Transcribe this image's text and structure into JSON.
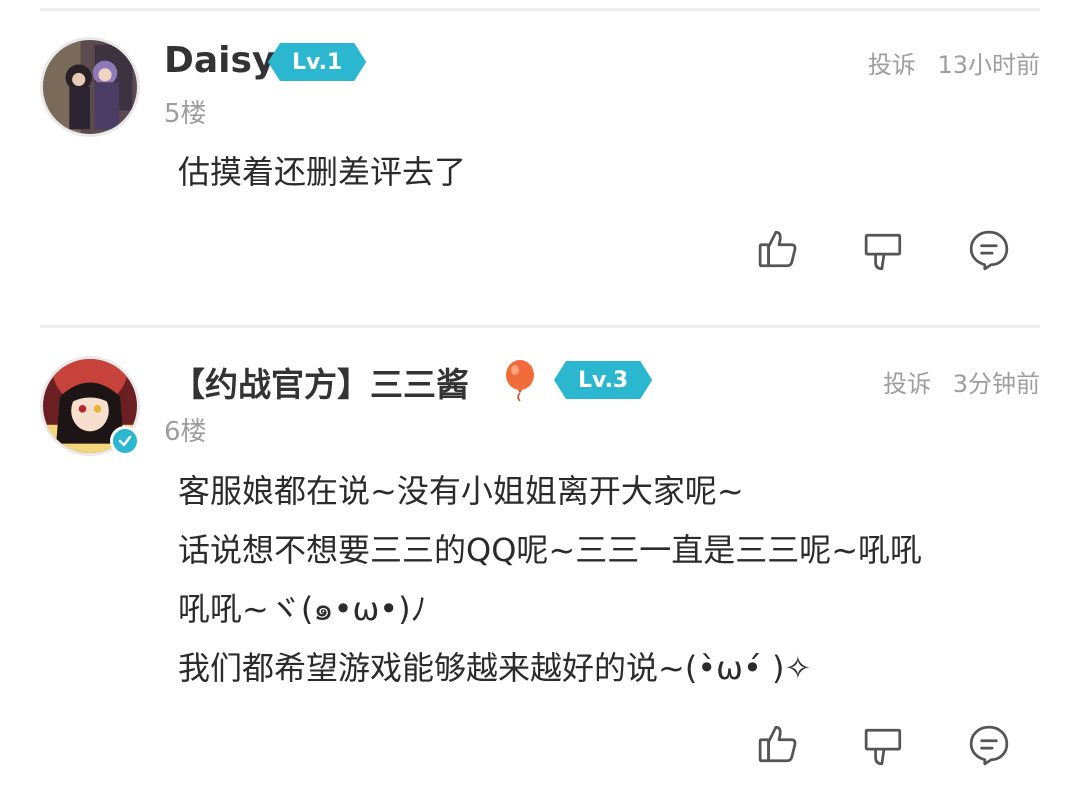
{
  "comments": [
    {
      "username": "Daisy",
      "level": "Lv.1",
      "floor": "5楼",
      "report_label": "投诉",
      "time": "13小时前",
      "verified": false,
      "badge_icon": null,
      "body_lines": [
        "估摸着还删差评去了"
      ]
    },
    {
      "username": "【约战官方】三三酱",
      "level": "Lv.3",
      "floor": "6楼",
      "report_label": "投诉",
      "time": "3分钟前",
      "verified": true,
      "badge_icon": "balloon-icon",
      "body_lines": [
        "客服娘都在说~没有小姐姐离开大家呢~",
        "话说想不想要三三的QQ呢~三三一直是三三呢~吼吼",
        "吼吼~ヾ(๑•ω•)ﾉ",
        "我们都希望游戏能够越来越好的说~(•̀ω•́ )✧"
      ]
    }
  ],
  "icons": [
    "thumbs-up-icon",
    "thumbs-down-icon",
    "reply-icon",
    "verified-check-icon"
  ],
  "colors": {
    "accent": "#2bb7d0",
    "muted": "#9e9e9e",
    "text": "#2b2b2b",
    "balloon": "#f26b3a"
  }
}
